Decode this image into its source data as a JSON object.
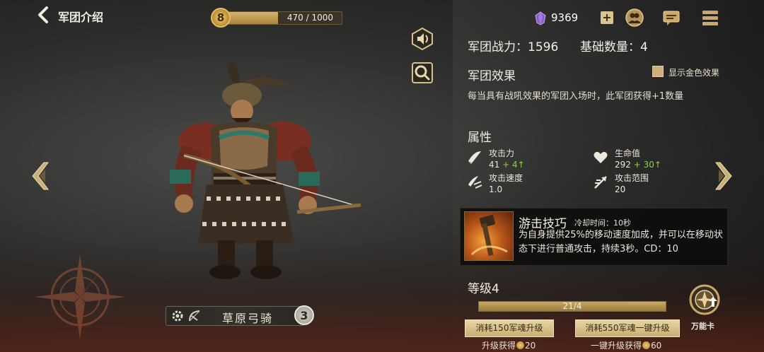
{
  "header": {
    "title": "军团介绍",
    "player_level": "8",
    "xp_text": "470 / 1000",
    "xp_progress": 0.47
  },
  "currency": {
    "gem_count": "9369",
    "plus_label": "+"
  },
  "icons": {
    "back": "back-arrow-icon",
    "gem": "purple-gem-icon",
    "friends": "friends-icon",
    "chat": "chat-icon",
    "menu": "menu-icon",
    "sound": "sound-icon",
    "zoom": "magnifier-icon"
  },
  "unit": {
    "name": "草原弓骑",
    "star_level": "3"
  },
  "stats": {
    "power_line": "军团战力：1596",
    "count_line": "基础数量：4"
  },
  "effect": {
    "heading": "军团效果",
    "gold_toggle_label": "显示金色效果",
    "description": "每当具有战吼效果的军团入场时，此军团获得+1数量"
  },
  "attributes": {
    "heading": "属性",
    "items": [
      {
        "label": "攻击力",
        "value": "41",
        "bonus": "+ 4↑",
        "icon": "sword-slash-icon"
      },
      {
        "label": "生命值",
        "value": "292",
        "bonus": "+ 30↑",
        "icon": "heart-icon"
      },
      {
        "label": "攻击速度",
        "value": "1.0",
        "bonus": "",
        "icon": "attack-speed-icon"
      },
      {
        "label": "攻击范围",
        "value": "20",
        "bonus": "",
        "icon": "range-arrow-icon"
      }
    ]
  },
  "skill": {
    "name": "游击技巧",
    "cooldown": "冷却时间：10秒",
    "description": "为自身提供25%的移动速度加成，并可以在移动状态下进行普通攻击，持续3秒。CD：10"
  },
  "level": {
    "heading": "等级4",
    "progress_text": "21/4",
    "progress": 1.0
  },
  "upgrade": {
    "single_button": "消耗150军魂升级",
    "single_note_prefix": "升级获得",
    "single_note_value": "20",
    "all_button": "消耗550军魂一键升级",
    "all_note_prefix": "一键升级获得",
    "all_note_value": "60"
  },
  "omni_card": {
    "label": "万能卡"
  },
  "colors": {
    "accent_gold": "#d4b36a",
    "bonus_green": "#8ecf4a",
    "button_gold": "#e7d5a6"
  }
}
